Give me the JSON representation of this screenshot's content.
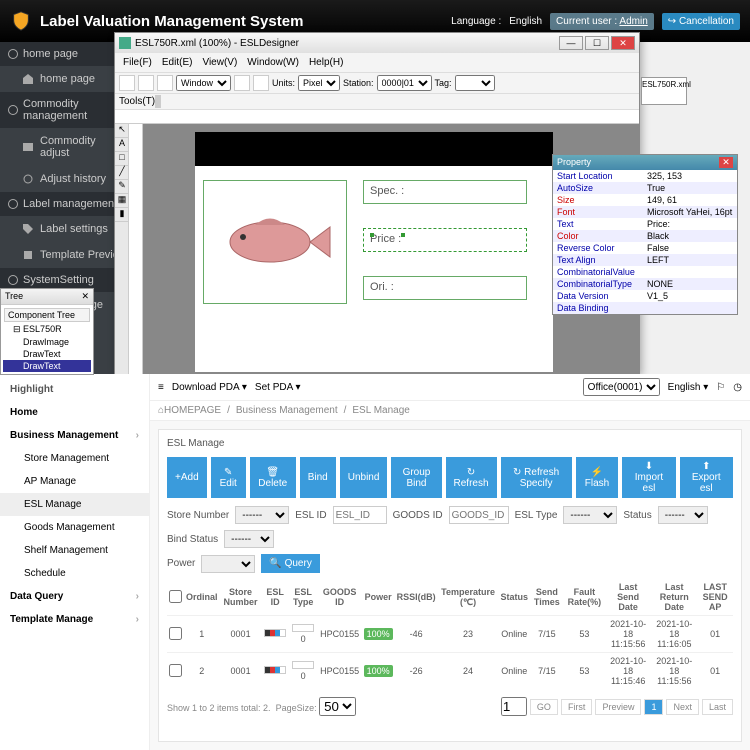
{
  "header": {
    "title": "Label Valuation Management System",
    "language_lbl": "Language :",
    "language": "English",
    "current_user_lbl": "Current user :",
    "user": "Admin",
    "cancel": "Cancellation"
  },
  "sidebar": {
    "s0": {
      "hdr": "home page",
      "i0": "home page"
    },
    "s1": {
      "hdr": "Commodity management",
      "i0": "Commodity adjust",
      "i1": "Adjust history"
    },
    "s2": {
      "hdr": "Label management",
      "i0": "Label settings",
      "i1": "Template Preview"
    },
    "s3": {
      "hdr": "SystemSetting",
      "i0": "UserManage"
    }
  },
  "designer": {
    "title": "ESL750R.xml (100%) - ESLDesigner",
    "menu": {
      "file": "File(F)",
      "edit": "Edit(E)",
      "view": "View(V)",
      "window": "Window(W)",
      "help": "Help(H)"
    },
    "tbar": {
      "window": "Window",
      "units_lbl": "Units:",
      "units": "Pixel",
      "station_lbl": "Station:",
      "station": "0000|01",
      "tag_lbl": "Tag:"
    },
    "tbar2": "Tools(T)",
    "tab": "ESL750R.xml",
    "fields": {
      "spec": "Spec. :",
      "price": "Price :",
      "ori": "Ori. :"
    }
  },
  "tree": {
    "title": "Tree",
    "tab": "Component Tree",
    "root": "ESL750R",
    "n0": "DrawImage",
    "n1": "DrawText",
    "n2": "DrawText"
  },
  "prop": {
    "title": "Property",
    "rows": [
      {
        "k": "Start Location",
        "v": "325, 153"
      },
      {
        "k": "AutoSize",
        "v": "True"
      },
      {
        "k": "Size",
        "v": "149, 61"
      },
      {
        "k": "Font",
        "v": "Microsoft YaHei, 16pt"
      },
      {
        "k": "Text",
        "v": "Price:"
      },
      {
        "k": "Color",
        "v": "Black"
      },
      {
        "k": "Reverse Color",
        "v": "False"
      },
      {
        "k": "Text Align",
        "v": "LEFT"
      },
      {
        "k": "CombinatorialValue",
        "v": ""
      },
      {
        "k": "CombinatorialType",
        "v": "NONE"
      },
      {
        "k": "Data Version",
        "v": "V1_5"
      },
      {
        "k": "Data Binding",
        "v": ""
      }
    ]
  },
  "lower": {
    "highlight": "Highlight",
    "nav": {
      "home": "Home",
      "bm": "Business Management",
      "sm": "Store Management",
      "ap": "AP Manage",
      "esl": "ESL Manage",
      "gm": "Goods Management",
      "shm": "Shelf Management",
      "sch": "Schedule",
      "dq": "Data Query",
      "tm": "Template Manage"
    },
    "top": {
      "dpda": "Download PDA",
      "spda": "Set PDA",
      "office": "Office(0001)",
      "lang": "English"
    },
    "bc": {
      "home": "HOMEPAGE",
      "bm": "Business Management",
      "esl": "ESL Manage"
    },
    "panel": "ESL Manage",
    "btns": {
      "add": "+Add",
      "edit": "Edit",
      "del": "Delete",
      "bind": "Bind",
      "unbind": "Unbind",
      "gbind": "Group Bind",
      "refresh": "Refresh",
      "rspec": "Refresh Specify",
      "flash": "Flash",
      "imp": "Import esl",
      "exp": "Export esl"
    },
    "filters": {
      "store": "Store Number",
      "storev": "------",
      "eslid": "ESL ID",
      "eslid_ph": "ESL_ID",
      "goods": "GOODS ID",
      "goods_ph": "GOODS_ID",
      "type": "ESL Type",
      "typev": "------",
      "status": "Status",
      "statusv": "------",
      "bstat": "Bind Status",
      "bstatv": "------",
      "power": "Power",
      "query": "Query"
    },
    "cols": {
      "ord": "Ordinal",
      "store": "Store Number",
      "eslid": "ESL ID",
      "type": "ESL Type",
      "goods": "GOODS ID",
      "power": "Power",
      "rssi": "RSSI(dB)",
      "temp": "Temperature (℃)",
      "status": "Status",
      "send": "Send Times",
      "fault": "Fault Rate(%)",
      "lsd": "Last Send Date",
      "lrd": "Last Return Date",
      "ap": "LAST SEND AP"
    },
    "rows": [
      {
        "ord": "1",
        "store": "0001",
        "eslid": "",
        "type": "0",
        "goods": "HPC0155",
        "power": "100%",
        "rssi": "-46",
        "temp": "23",
        "status": "Online",
        "send": "7/15",
        "fault": "53",
        "lsd": "2021-10-18 11:15:56",
        "lrd": "2021-10-18 11:16:05",
        "ap": "01"
      },
      {
        "ord": "2",
        "store": "0001",
        "eslid": "",
        "type": "0",
        "goods": "HPC0155",
        "power": "100%",
        "rssi": "-26",
        "temp": "24",
        "status": "Online",
        "send": "7/15",
        "fault": "53",
        "lsd": "2021-10-18 11:15:46",
        "lrd": "2021-10-18 11:15:56",
        "ap": "01"
      }
    ],
    "pagin": {
      "summary": "Show 1 to 2 items total: 2.",
      "ps": "PageSize:",
      "psv": "50",
      "page": "1",
      "go": "GO",
      "first": "First",
      "prev": "Preview",
      "p1": "1",
      "next": "Next",
      "last": "Last"
    }
  }
}
